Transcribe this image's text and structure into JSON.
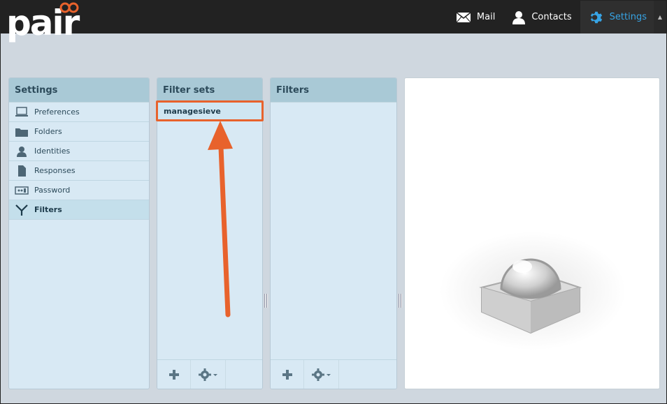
{
  "app": {
    "logo_text": "pair",
    "nav": [
      {
        "label": "Mail",
        "icon": "mail-icon"
      },
      {
        "label": "Contacts",
        "icon": "contacts-icon"
      },
      {
        "label": "Settings",
        "icon": "gear-icon",
        "active": true
      }
    ],
    "accent_color": "#37a4e5",
    "annotation_color": "#e8622c"
  },
  "settings_panel": {
    "title": "Settings",
    "items": [
      {
        "label": "Preferences",
        "icon": "laptop-icon"
      },
      {
        "label": "Folders",
        "icon": "folder-icon"
      },
      {
        "label": "Identities",
        "icon": "person-icon"
      },
      {
        "label": "Responses",
        "icon": "document-icon"
      },
      {
        "label": "Password",
        "icon": "password-icon"
      },
      {
        "label": "Filters",
        "icon": "filter-icon",
        "selected": true
      }
    ]
  },
  "filtersets_panel": {
    "title": "Filter sets",
    "items": [
      "managesieve"
    ],
    "footer": [
      "plus-icon",
      "gear-menu-icon"
    ]
  },
  "filters_panel": {
    "title": "Filters",
    "items": [],
    "footer": [
      "plus-icon",
      "gear-menu-icon"
    ]
  }
}
